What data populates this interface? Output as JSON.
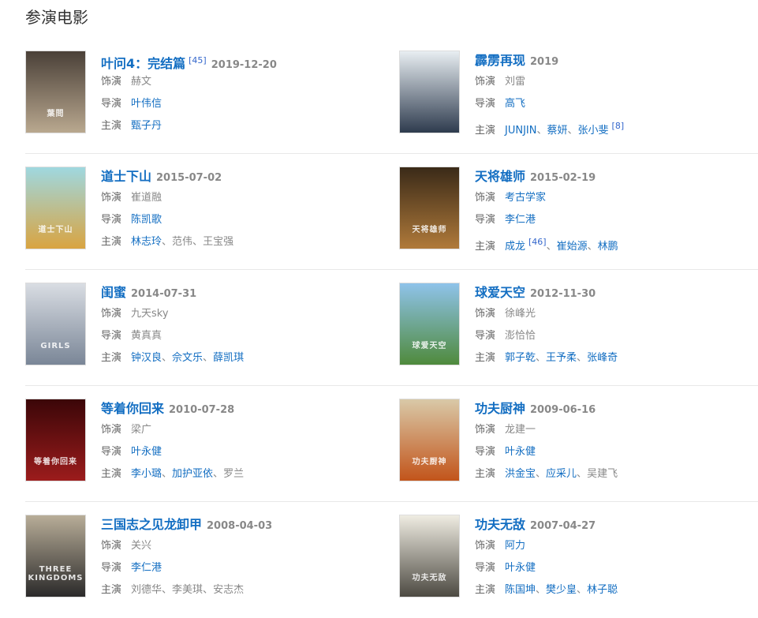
{
  "section": {
    "title": "参演电影"
  },
  "labels": {
    "role": "饰演",
    "director": "导演",
    "cast": "主演"
  },
  "movies": [
    {
      "title": "叶问4：完结篇",
      "note": "[45]",
      "date": "2019-12-20",
      "role": {
        "text": "赫文",
        "link": false
      },
      "director": {
        "text": "叶伟信",
        "link": true
      },
      "cast": [
        {
          "text": "甄子丹",
          "link": true
        }
      ],
      "poster_colors": [
        "#4a4038",
        "#b9a88f"
      ],
      "poster_text": "葉問"
    },
    {
      "title": "霹雳再现",
      "note": "",
      "date": "2019",
      "role": {
        "text": "刘雷",
        "link": false
      },
      "director": {
        "text": "高飞",
        "link": true
      },
      "cast": [
        {
          "text": "JUNJIN",
          "link": true
        },
        {
          "text": "蔡妍",
          "link": true
        },
        {
          "text": "张小斐",
          "link": true,
          "note": "[8]"
        }
      ],
      "poster_colors": [
        "#e8eef2",
        "#2e3b4e"
      ],
      "poster_text": ""
    },
    {
      "title": "道士下山",
      "note": "",
      "date": "2015-07-02",
      "role": {
        "text": "崔道融",
        "link": false
      },
      "director": {
        "text": "陈凯歌",
        "link": true
      },
      "cast": [
        {
          "text": "林志玲",
          "link": true
        },
        {
          "text": "范伟",
          "link": false
        },
        {
          "text": "王宝强",
          "link": false
        }
      ],
      "poster_colors": [
        "#9fd8e0",
        "#d9a441"
      ],
      "poster_text": "道士下山"
    },
    {
      "title": "天将雄师",
      "note": "",
      "date": "2015-02-19",
      "role": {
        "text": "考古学家",
        "link": true
      },
      "director": {
        "text": "李仁港",
        "link": true
      },
      "cast": [
        {
          "text": "成龙",
          "link": true,
          "note": "[46]"
        },
        {
          "text": "崔始源",
          "link": true
        },
        {
          "text": "林鹏",
          "link": true
        }
      ],
      "poster_colors": [
        "#3a2a18",
        "#b07a3a"
      ],
      "poster_text": "天将雄师"
    },
    {
      "title": "闺蜜",
      "note": "",
      "date": "2014-07-31",
      "role": {
        "text": "九天sky",
        "link": false
      },
      "director": {
        "text": "黄真真",
        "link": false
      },
      "cast": [
        {
          "text": "钟汉良",
          "link": true
        },
        {
          "text": "佘文乐",
          "link": true
        },
        {
          "text": "薛凯琪",
          "link": true
        }
      ],
      "poster_colors": [
        "#d9dde3",
        "#7a8697"
      ],
      "poster_text": "GIRLS"
    },
    {
      "title": "球爱天空",
      "note": "",
      "date": "2012-11-30",
      "role": {
        "text": "徐峰光",
        "link": false
      },
      "director": {
        "text": "澎恰恰",
        "link": false
      },
      "cast": [
        {
          "text": "郭子乾",
          "link": true
        },
        {
          "text": "王予柔",
          "link": true
        },
        {
          "text": "张峰奇",
          "link": true
        }
      ],
      "poster_colors": [
        "#8fc3ea",
        "#4f8a3c"
      ],
      "poster_text": "球爱天空"
    },
    {
      "title": "等着你回来",
      "note": "",
      "date": "2010-07-28",
      "role": {
        "text": "梁广",
        "link": false
      },
      "director": {
        "text": "叶永健",
        "link": true
      },
      "cast": [
        {
          "text": "李小璐",
          "link": true
        },
        {
          "text": "加护亚依",
          "link": true
        },
        {
          "text": "罗兰",
          "link": false
        }
      ],
      "poster_colors": [
        "#3b0608",
        "#9c1c1c"
      ],
      "poster_text": "等着你回来"
    },
    {
      "title": "功夫厨神",
      "note": "",
      "date": "2009-06-16",
      "role": {
        "text": "龙建一",
        "link": false
      },
      "director": {
        "text": "叶永健",
        "link": true
      },
      "cast": [
        {
          "text": "洪金宝",
          "link": true
        },
        {
          "text": "应采儿",
          "link": true
        },
        {
          "text": "吴建飞",
          "link": false
        }
      ],
      "poster_colors": [
        "#d9c9a8",
        "#c2541a"
      ],
      "poster_text": "功夫厨神"
    },
    {
      "title": "三国志之见龙卸甲",
      "note": "",
      "date": "2008-04-03",
      "role": {
        "text": "关兴",
        "link": false
      },
      "director": {
        "text": "李仁港",
        "link": true
      },
      "cast": [
        {
          "text": "刘德华",
          "link": false
        },
        {
          "text": "李美琪",
          "link": false
        },
        {
          "text": "安志杰",
          "link": false
        }
      ],
      "poster_colors": [
        "#b8ad98",
        "#2b2a2a"
      ],
      "poster_text": "THREE KINGDOMS"
    },
    {
      "title": "功夫无敌",
      "note": "",
      "date": "2007-04-27",
      "role": {
        "text": "阿力",
        "link": true
      },
      "director": {
        "text": "叶永健",
        "link": true
      },
      "cast": [
        {
          "text": "陈国坤",
          "link": true
        },
        {
          "text": "樊少皇",
          "link": true
        },
        {
          "text": "林子聪",
          "link": true
        }
      ],
      "poster_colors": [
        "#efece2",
        "#4d4a42"
      ],
      "poster_text": "功夫无敌"
    }
  ]
}
